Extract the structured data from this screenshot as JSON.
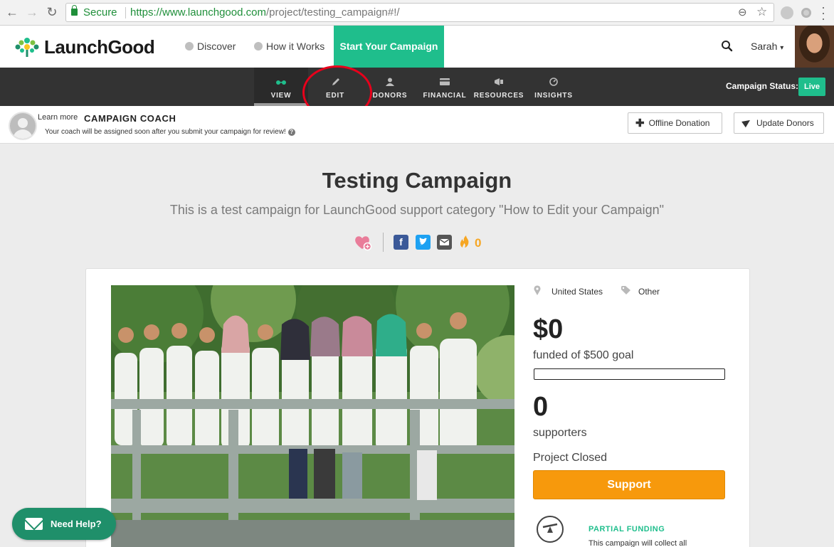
{
  "browser": {
    "secure_label": "Secure",
    "url_scheme": "https://",
    "url_host": "www.launchgood.com",
    "url_path": "/project/testing_campaign#!/"
  },
  "header": {
    "brand": "LaunchGood",
    "nav": [
      {
        "label": "Discover",
        "icon": "globe-icon"
      },
      {
        "label": "How it Works",
        "icon": "info-icon"
      }
    ],
    "cta": "Start Your Campaign",
    "user_name": "Sarah",
    "user_caret": "▾"
  },
  "dashboard": {
    "tabs": [
      {
        "label": "VIEW",
        "icon": "glasses-icon"
      },
      {
        "label": "EDIT",
        "icon": "pencil-icon"
      },
      {
        "label": "DONORS",
        "icon": "person-icon"
      },
      {
        "label": "FINANCIAL",
        "icon": "card-icon"
      },
      {
        "label": "RESOURCES",
        "icon": "megaphone-icon"
      },
      {
        "label": "INSIGHTS",
        "icon": "gauge-icon"
      }
    ],
    "active_tab": "VIEW",
    "status_label": "Campaign Status:",
    "status_value": "Live"
  },
  "coach": {
    "learn_more": "Learn more",
    "title": "CAMPAIGN COACH",
    "description": "Your coach will be assigned soon after you submit your campaign for review!",
    "offline_donation": "Offline Donation",
    "update_donors": "Update Donors"
  },
  "campaign": {
    "title": "Testing Campaign",
    "subtitle": "This is a test campaign for LaunchGood support category \"How to Edit your Campaign\"",
    "flame_count": "0",
    "location": "United States",
    "category": "Other",
    "amount_raised": "$0",
    "goal_text": "funded of $500 goal",
    "progress_percent": 0,
    "supporters_count": "0",
    "supporters_label": "supporters",
    "status_text": "Project Closed",
    "support_button": "Support",
    "funding_title": "PARTIAL FUNDING",
    "funding_text": "This campaign will collect all"
  },
  "help": {
    "label": "Need Help?"
  },
  "colors": {
    "brand_green": "#1fbe8c",
    "support_orange": "#f7990c",
    "dash_bg": "#333333",
    "annotation_red": "#e8001b"
  }
}
